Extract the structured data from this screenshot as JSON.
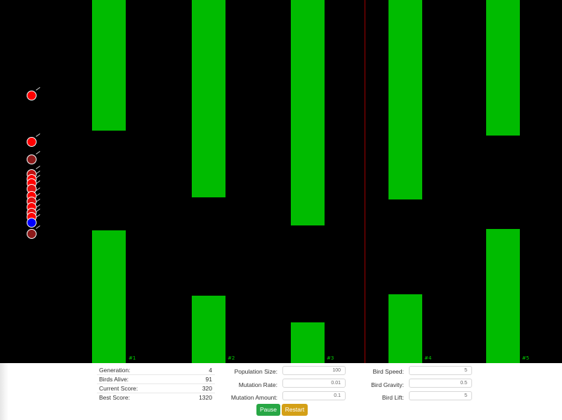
{
  "pipes": [
    {
      "label": "#1"
    },
    {
      "label": "#2"
    },
    {
      "label": "#3"
    },
    {
      "label": "#4"
    },
    {
      "label": "#5"
    }
  ],
  "stats": [
    {
      "label": "Generation:",
      "value": "4"
    },
    {
      "label": "Birds Alive:",
      "value": "91"
    },
    {
      "label": "Current Score:",
      "value": "320"
    },
    {
      "label": "Best Score:",
      "value": "1320"
    }
  ],
  "params_mid": [
    {
      "label": "Population Size:",
      "value": "100"
    },
    {
      "label": "Mutation Rate:",
      "value": "0.01"
    },
    {
      "label": "Mutation Amount:",
      "value": "0.1"
    }
  ],
  "params_right": [
    {
      "label": "Bird Speed:",
      "value": "5"
    },
    {
      "label": "Bird Gravity:",
      "value": "0.5"
    },
    {
      "label": "Bird Lift:",
      "value": "5"
    }
  ],
  "buttons": {
    "pause": "Pause",
    "restart": "Restart"
  },
  "colors": {
    "pipe": "#00bb00",
    "bird_alive": "#ff0000",
    "bird_dark": "#8b1a1a",
    "bird_best": "#0000ff",
    "pause": "#28a745",
    "restart": "#d4a017"
  }
}
